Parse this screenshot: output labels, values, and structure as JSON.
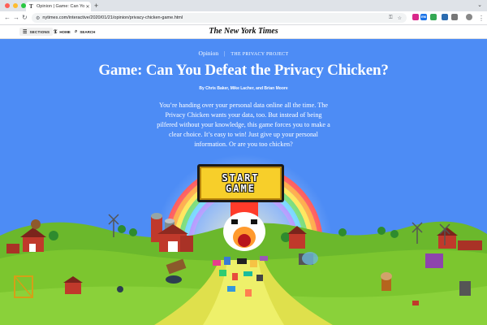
{
  "browser": {
    "tab_title": "Opinion | Game: Can You De…",
    "tab_favicon": "T",
    "url": "nytimes.com/interactive/2020/01/21/opinion/privacy-chicken-game.html",
    "dot_colors": [
      "#ff5f57",
      "#febc2e",
      "#28c840"
    ],
    "ext_badge": "EM"
  },
  "header": {
    "sections_label": "SECTIONS",
    "home_label": "HOME",
    "search_label": "SEARCH",
    "logo_text": "The New York Times"
  },
  "article": {
    "section": "Opinion",
    "project": "THE PRIVACY PROJECT",
    "headline": "Game: Can You Defeat the Privacy Chicken?",
    "byline": "By Chris Baker, Mike Lacher, and Brian Moore",
    "dek": "You’re handing over your personal data online all the time. The Privacy Chicken wants your data, too. But instead of being pilfered without your knowledge, this game forces you to make a clear choice. It’s easy to win! Just give up your personal information. Or are you too chicken?"
  },
  "game": {
    "start_line1": "START",
    "start_line2": "GAME"
  },
  "colors": {
    "sky": "#4d8cf5",
    "start_yellow": "#f7cf2a",
    "grass": "#7cc62f",
    "road": "#d8d84a"
  }
}
